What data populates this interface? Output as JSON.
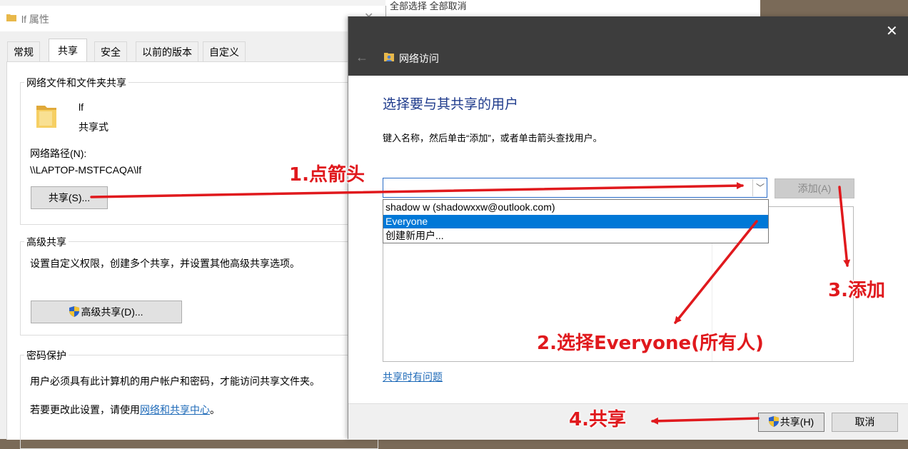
{
  "background": {
    "explorer_text": "全部选择 全部取消"
  },
  "properties_window": {
    "title": "lf 属性",
    "tabs": [
      "常规",
      "共享",
      "安全",
      "以前的版本",
      "自定义"
    ],
    "active_tab": "共享",
    "network_sharing": {
      "group_title": "网络文件和文件夹共享",
      "folder_name": "lf",
      "folder_status": "共享式",
      "network_path_label": "网络路径(N):",
      "network_path": "\\\\LAPTOP-MSTFCAQA\\lf",
      "share_button": "共享(S)..."
    },
    "advanced_sharing": {
      "group_title": "高级共享",
      "description": "设置自定义权限，创建多个共享，并设置其他高级共享选项。",
      "button": "高级共享(D)..."
    },
    "password_protection": {
      "group_title": "密码保护",
      "description": "用户必须具有此计算机的用户帐户和密码，才能访问共享文件夹。",
      "change_prefix": "若要更改此设置，请使用",
      "change_link": "网络和共享中心",
      "change_suffix": "。"
    }
  },
  "network_access_dialog": {
    "title": "网络访问",
    "heading": "选择要与其共享的用户",
    "instruction": "键入名称，然后单击“添加”，或者单击箭头查找用户。",
    "add_button": "添加(A)",
    "dropdown_options": [
      "shadow w (shadowxxw@outlook.com)",
      "Everyone",
      "创建新用户..."
    ],
    "selected_option": "Everyone",
    "trouble_link": "共享时有问题",
    "share_button": "共享(H)",
    "cancel_button": "取消"
  },
  "annotations": {
    "step1": "1.点箭头",
    "step2": "2.选择Everyone(所有人)",
    "step3": "3.添加",
    "step4": "4.共享"
  },
  "colors": {
    "annotation_red": "#e0191d",
    "selection_blue": "#0078d7",
    "heading_blue": "#1f3b8c",
    "dialog_header": "#3d3d3d"
  }
}
